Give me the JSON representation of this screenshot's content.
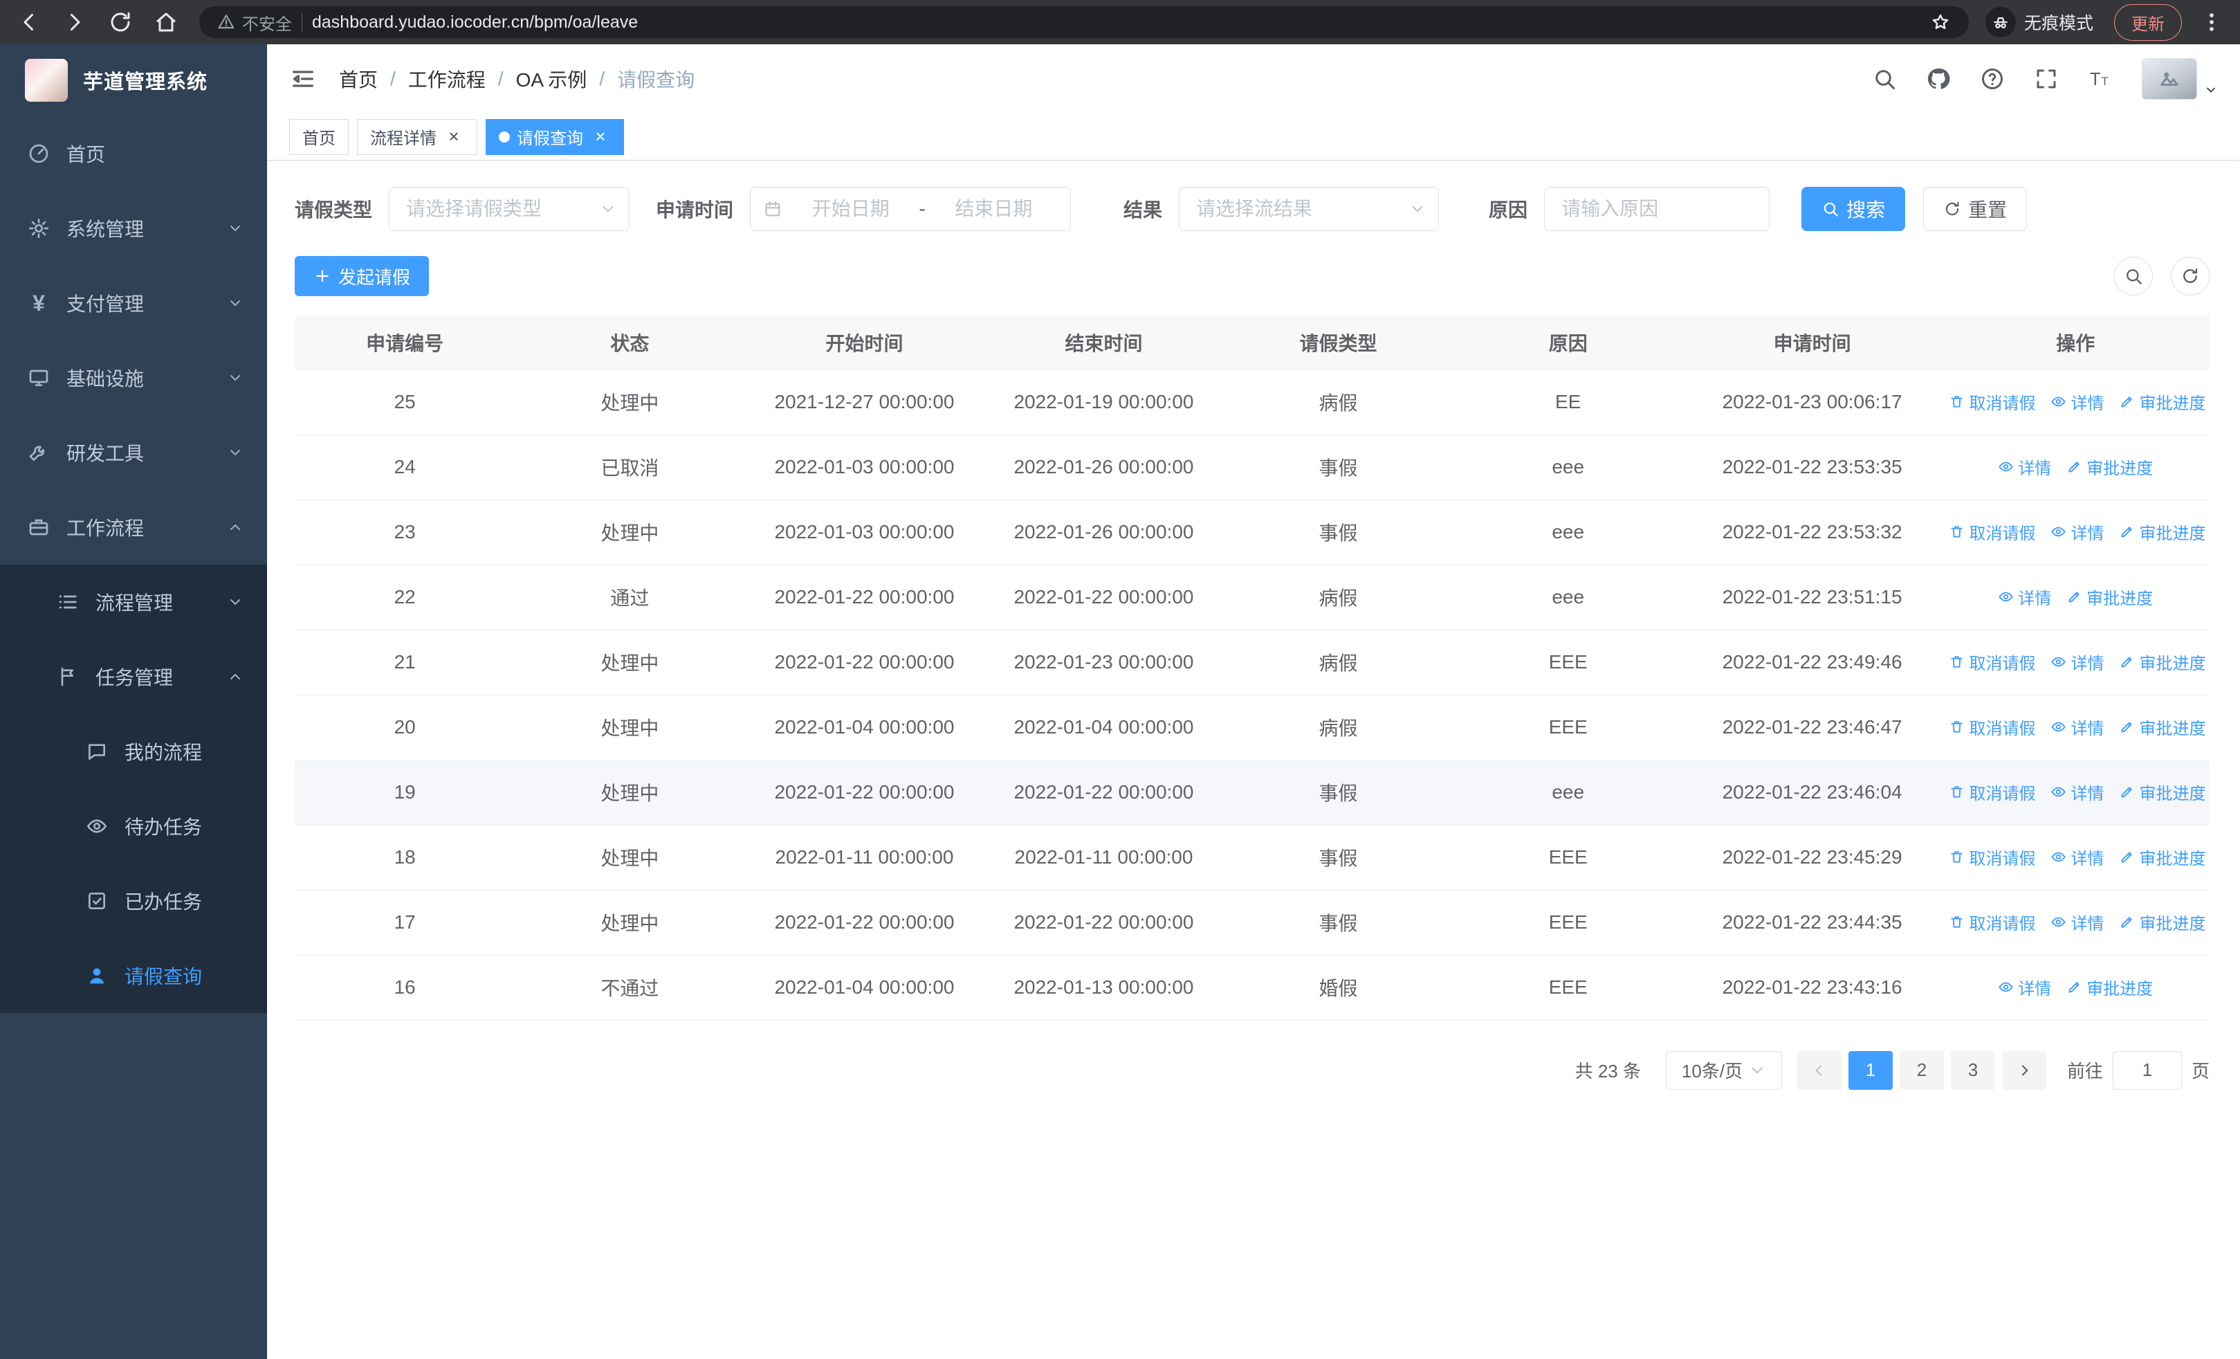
{
  "browser": {
    "nav_icons": [
      "back-icon",
      "forward-icon",
      "reload-icon",
      "home-icon"
    ],
    "security_warning": "不安全",
    "url": "dashboard.yudao.iocoder.cn/bpm/oa/leave",
    "incognito_label": "无痕模式",
    "update_label": "更新"
  },
  "colors": {
    "accent": "#409eff",
    "sidebar_bg": "#304156",
    "submenu_bg": "#1f2d3d",
    "chrome_bg": "#35363a"
  },
  "sidebar": {
    "logo_title": "芋道管理系统",
    "items": [
      {
        "id": "home",
        "label": "首页",
        "icon": "dashboard-icon",
        "level": 1,
        "expandable": false,
        "group": false
      },
      {
        "id": "system-management",
        "label": "系统管理",
        "icon": "gear-icon",
        "level": 1,
        "expandable": true,
        "expanded": false,
        "group": false
      },
      {
        "id": "payment-management",
        "label": "支付管理",
        "icon": "yen-icon",
        "level": 1,
        "expandable": true,
        "expanded": false,
        "group": false
      },
      {
        "id": "infrastructure",
        "label": "基础设施",
        "icon": "monitor-icon",
        "level": 1,
        "expandable": true,
        "expanded": false,
        "group": false
      },
      {
        "id": "dev-tools",
        "label": "研发工具",
        "icon": "wrench-icon",
        "level": 1,
        "expandable": true,
        "expanded": false,
        "group": false
      },
      {
        "id": "workflow",
        "label": "工作流程",
        "icon": "briefcase-icon",
        "level": 1,
        "expandable": true,
        "expanded": true,
        "group": false
      },
      {
        "id": "process-management",
        "label": "流程管理",
        "icon": "list-icon",
        "level": 2,
        "expandable": true,
        "expanded": false,
        "group": true
      },
      {
        "id": "task-management",
        "label": "任务管理",
        "icon": "flag-icon",
        "level": 2,
        "expandable": true,
        "expanded": true,
        "group": true
      },
      {
        "id": "my-process",
        "label": "我的流程",
        "icon": "chat-icon",
        "level": 3,
        "expandable": false,
        "group": true
      },
      {
        "id": "todo-tasks",
        "label": "待办任务",
        "icon": "eye-icon",
        "level": 3,
        "expandable": false,
        "group": true
      },
      {
        "id": "done-tasks",
        "label": "已办任务",
        "icon": "check-square-icon",
        "level": 3,
        "expandable": false,
        "group": true
      },
      {
        "id": "leave-query",
        "label": "请假查询",
        "icon": "user-icon",
        "level": 3,
        "expandable": false,
        "group": true,
        "active": true
      }
    ]
  },
  "header": {
    "breadcrumb": [
      "首页",
      "工作流程",
      "OA 示例",
      "请假查询"
    ],
    "breadcrumb_separator": "/",
    "action_icons": [
      "search-icon",
      "github-icon",
      "help-icon",
      "fullscreen-icon",
      "font-size-icon"
    ]
  },
  "tabs": [
    {
      "id": "home",
      "label": "首页",
      "closable": false,
      "active": false
    },
    {
      "id": "process-detail",
      "label": "流程详情",
      "closable": true,
      "active": false
    },
    {
      "id": "leave-query",
      "label": "请假查询",
      "closable": true,
      "active": true
    }
  ],
  "filters": {
    "leave_type_label": "请假类型",
    "leave_type_placeholder": "请选择请假类型",
    "apply_time_label": "申请时间",
    "start_date_placeholder": "开始日期",
    "range_separator": "-",
    "end_date_placeholder": "结束日期",
    "result_label": "结果",
    "result_placeholder": "请选择流结果",
    "reason_label": "原因",
    "reason_placeholder": "请输入原因",
    "search_label": "搜索",
    "reset_label": "重置"
  },
  "toolbar": {
    "create_label": "发起请假"
  },
  "table": {
    "headers": [
      "申请编号",
      "状态",
      "开始时间",
      "结束时间",
      "请假类型",
      "原因",
      "申请时间",
      "操作"
    ],
    "action_labels": {
      "cancel": "取消请假",
      "detail": "详情",
      "progress": "审批进度"
    },
    "rows": [
      {
        "id": "25",
        "status": "处理中",
        "start": "2021-12-27 00:00:00",
        "end": "2022-01-19 00:00:00",
        "type": "病假",
        "reason": "EE",
        "applied": "2022-01-23 00:06:17",
        "actions": [
          "cancel",
          "detail",
          "progress"
        ],
        "highlighted": false
      },
      {
        "id": "24",
        "status": "已取消",
        "start": "2022-01-03 00:00:00",
        "end": "2022-01-26 00:00:00",
        "type": "事假",
        "reason": "eee",
        "applied": "2022-01-22 23:53:35",
        "actions": [
          "detail",
          "progress"
        ],
        "highlighted": false
      },
      {
        "id": "23",
        "status": "处理中",
        "start": "2022-01-03 00:00:00",
        "end": "2022-01-26 00:00:00",
        "type": "事假",
        "reason": "eee",
        "applied": "2022-01-22 23:53:32",
        "actions": [
          "cancel",
          "detail",
          "progress"
        ],
        "highlighted": false
      },
      {
        "id": "22",
        "status": "通过",
        "start": "2022-01-22 00:00:00",
        "end": "2022-01-22 00:00:00",
        "type": "病假",
        "reason": "eee",
        "applied": "2022-01-22 23:51:15",
        "actions": [
          "detail",
          "progress"
        ],
        "highlighted": false
      },
      {
        "id": "21",
        "status": "处理中",
        "start": "2022-01-22 00:00:00",
        "end": "2022-01-23 00:00:00",
        "type": "病假",
        "reason": "EEE",
        "applied": "2022-01-22 23:49:46",
        "actions": [
          "cancel",
          "detail",
          "progress"
        ],
        "highlighted": false
      },
      {
        "id": "20",
        "status": "处理中",
        "start": "2022-01-04 00:00:00",
        "end": "2022-01-04 00:00:00",
        "type": "病假",
        "reason": "EEE",
        "applied": "2022-01-22 23:46:47",
        "actions": [
          "cancel",
          "detail",
          "progress"
        ],
        "highlighted": false
      },
      {
        "id": "19",
        "status": "处理中",
        "start": "2022-01-22 00:00:00",
        "end": "2022-01-22 00:00:00",
        "type": "事假",
        "reason": "eee",
        "applied": "2022-01-22 23:46:04",
        "actions": [
          "cancel",
          "detail",
          "progress"
        ],
        "highlighted": true
      },
      {
        "id": "18",
        "status": "处理中",
        "start": "2022-01-11 00:00:00",
        "end": "2022-01-11 00:00:00",
        "type": "事假",
        "reason": "EEE",
        "applied": "2022-01-22 23:45:29",
        "actions": [
          "cancel",
          "detail",
          "progress"
        ],
        "highlighted": false
      },
      {
        "id": "17",
        "status": "处理中",
        "start": "2022-01-22 00:00:00",
        "end": "2022-01-22 00:00:00",
        "type": "事假",
        "reason": "EEE",
        "applied": "2022-01-22 23:44:35",
        "actions": [
          "cancel",
          "detail",
          "progress"
        ],
        "highlighted": false
      },
      {
        "id": "16",
        "status": "不通过",
        "start": "2022-01-04 00:00:00",
        "end": "2022-01-13 00:00:00",
        "type": "婚假",
        "reason": "EEE",
        "applied": "2022-01-22 23:43:16",
        "actions": [
          "detail",
          "progress"
        ],
        "highlighted": false
      }
    ]
  },
  "pagination": {
    "total_text": "共 23 条",
    "page_size": "10条/页",
    "pages": [
      "1",
      "2",
      "3"
    ],
    "active_page": "1",
    "goto_label": "前往",
    "goto_value": "1",
    "goto_suffix": "页"
  }
}
